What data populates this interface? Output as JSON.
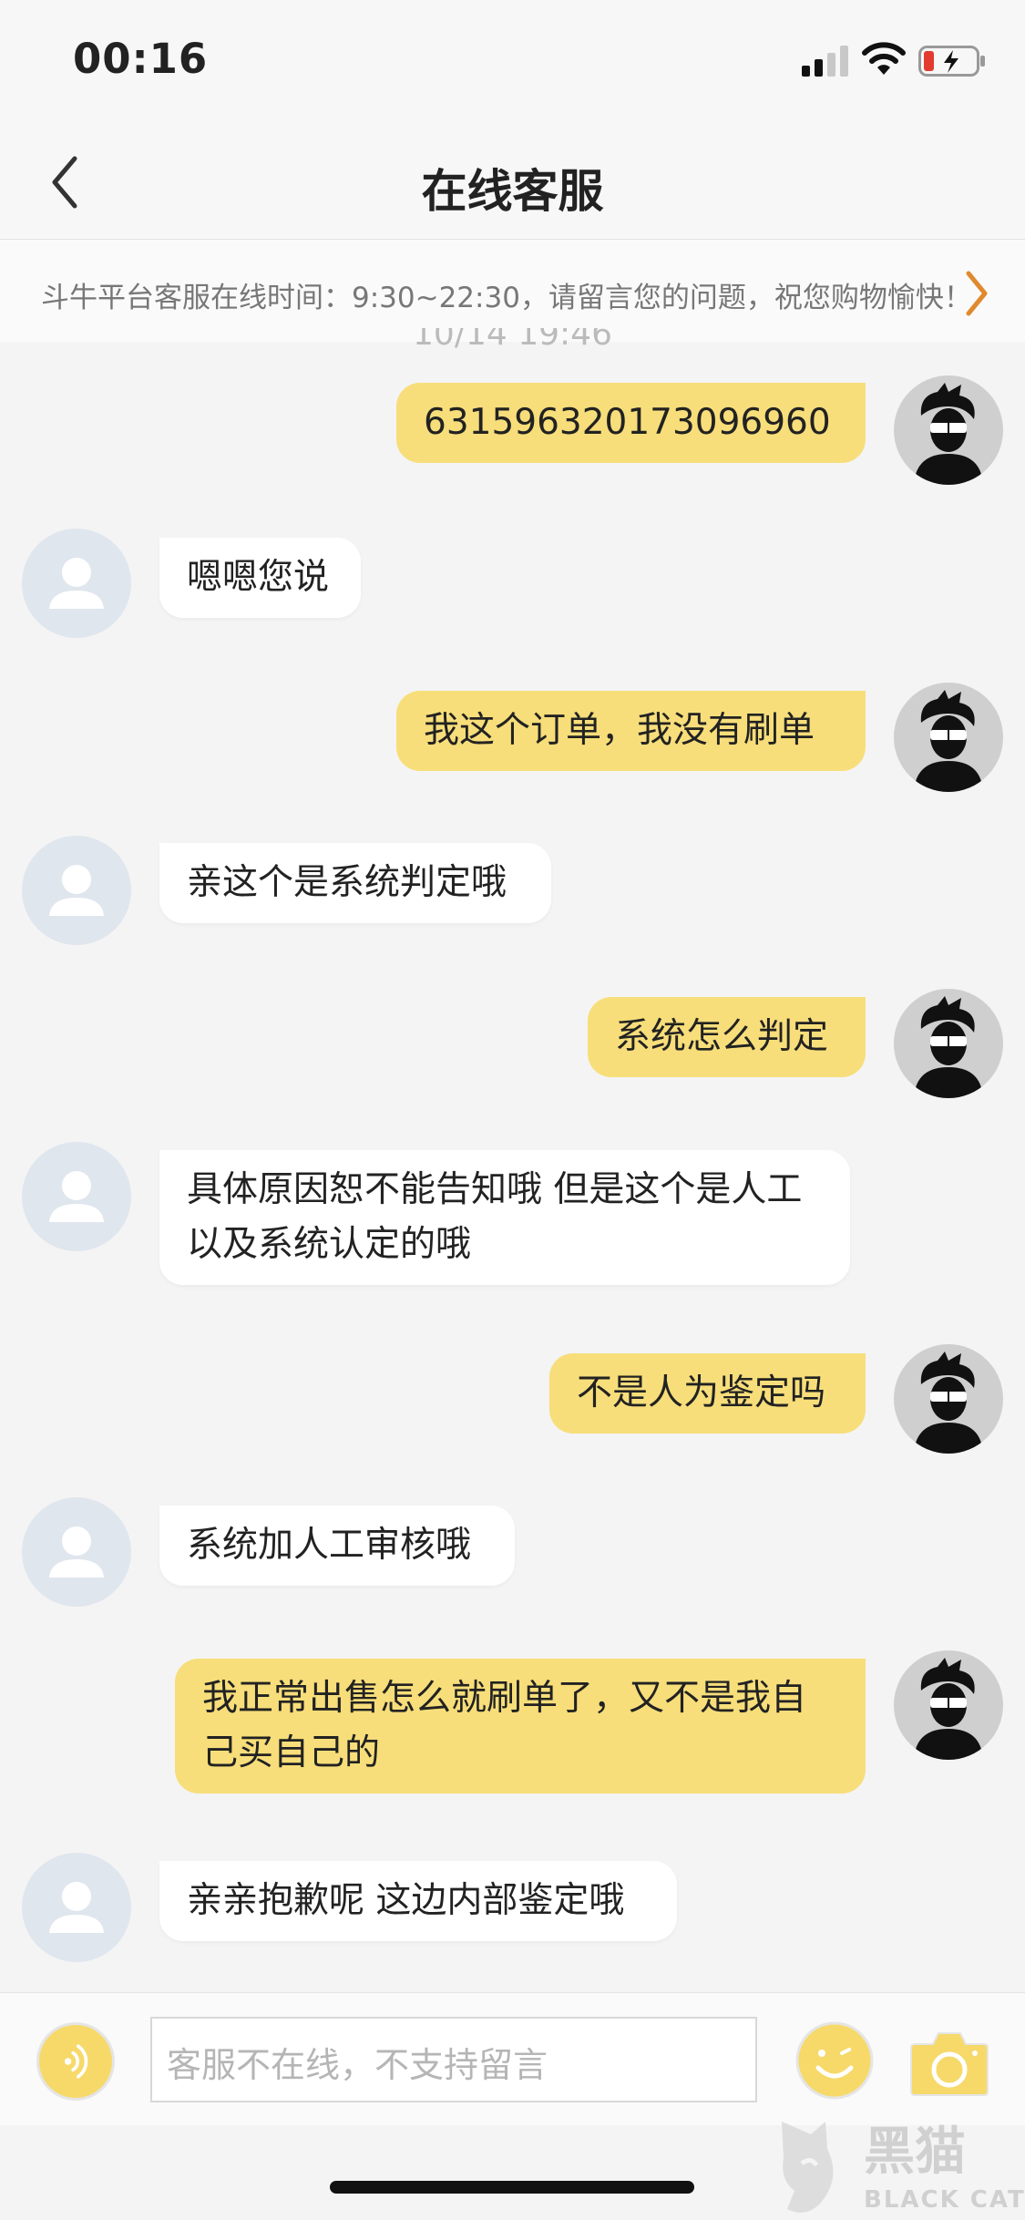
{
  "status_bar": {
    "time": "00:16"
  },
  "nav": {
    "title": "在线客服"
  },
  "notice": {
    "text": "斗牛平台客服在线时间：9:30~22:30，请留言您的问题，祝您购物愉快！"
  },
  "timestamp": "10/14 19:46",
  "messages": [
    {
      "from": "me",
      "text": "631596320173096960"
    },
    {
      "from": "service",
      "text": "嗯嗯您说"
    },
    {
      "from": "me",
      "text": "我这个订单，我没有刷单"
    },
    {
      "from": "service",
      "text": "亲这个是系统判定哦"
    },
    {
      "from": "me",
      "text": "系统怎么判定"
    },
    {
      "from": "service",
      "text": "具体原因恕不能告知哦  但是这个是人工以及系统认定的哦"
    },
    {
      "from": "me",
      "text": "不是人为鉴定吗"
    },
    {
      "from": "service",
      "text": "系统加人工审核哦"
    },
    {
      "from": "me",
      "text": "我正常出售怎么就刷单了，又不是我自己买自己的"
    },
    {
      "from": "service",
      "text": "亲亲抱歉呢 这边内部鉴定哦"
    }
  ],
  "input": {
    "placeholder": "客服不在线，不支持留言"
  },
  "watermark": {
    "cn": "黑猫",
    "en": "BLACK CAT"
  },
  "colors": {
    "my_bubble": "#f7de7a",
    "accent_arrow": "#e08a2e",
    "icon_yellow": "#f6d969"
  },
  "icons": [
    "back-chevron",
    "voice",
    "emoji",
    "camera",
    "signal",
    "wifi",
    "battery"
  ]
}
